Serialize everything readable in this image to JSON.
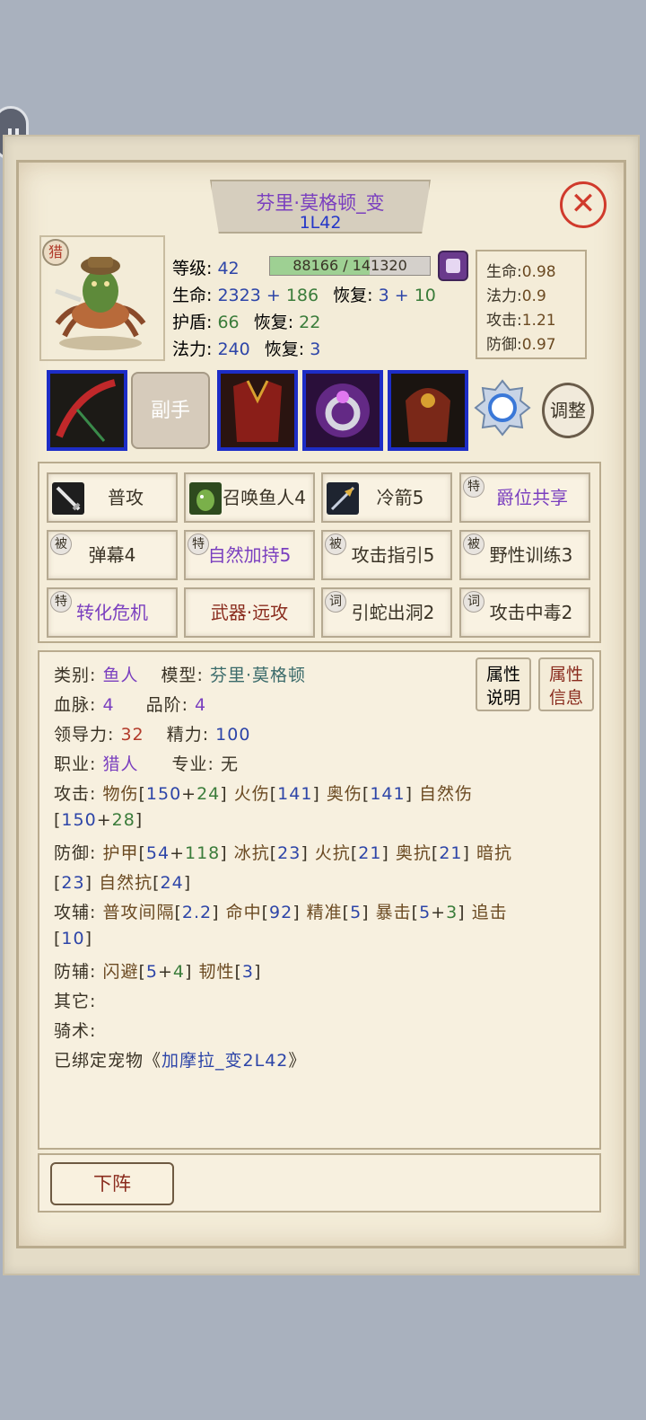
{
  "title": {
    "name": "芬里·莫格顿_变",
    "level": "1L42"
  },
  "badge": "猎",
  "stats": {
    "level_label": "等级:",
    "level_value": "42",
    "exp_text": "88166 / 141320",
    "exp_progress": 0.624,
    "hp_label": "生命:",
    "hp_base": "2323",
    "hp_plus": "+",
    "hp_bonus": "186",
    "hp_regen_label": "恢复:",
    "hp_regen_base": "3",
    "hp_regen_plus": "+",
    "hp_regen_bonus": "10",
    "shield_label": "护盾:",
    "shield_value": "66",
    "shield_regen_label": "恢复:",
    "shield_regen_value": "22",
    "mana_label": "法力:",
    "mana_value": "240",
    "mana_regen_label": "恢复:",
    "mana_regen_value": "3"
  },
  "growth": [
    {
      "label": "生命:",
      "value": "0.98"
    },
    {
      "label": "法力:",
      "value": "0.9"
    },
    {
      "label": "攻击:",
      "value": "1.21"
    },
    {
      "label": "防御:",
      "value": "0.97"
    }
  ],
  "equipment": {
    "offhand_label": "副手",
    "adjust_label": "调整"
  },
  "skills": [
    {
      "label": "普攻",
      "tag": ""
    },
    {
      "label": "召唤鱼人4",
      "tag": ""
    },
    {
      "label": "冷箭5",
      "tag": ""
    },
    {
      "label": "爵位共享",
      "tag": "特"
    },
    {
      "label": "弹幕4",
      "tag": "被"
    },
    {
      "label": "自然加持5",
      "tag": "特"
    },
    {
      "label": "攻击指引5",
      "tag": "被"
    },
    {
      "label": "野性训练3",
      "tag": "被"
    },
    {
      "label": "转化危机",
      "tag": "特"
    },
    {
      "label": "武器·远攻",
      "tag": ""
    },
    {
      "label": "引蛇出洞2",
      "tag": "词"
    },
    {
      "label": "攻击中毒2",
      "tag": "词"
    }
  ],
  "info": {
    "category_label": "类别:",
    "category_value": "鱼人",
    "model_label": "模型:",
    "model_value": "芬里·莫格顿",
    "bloodline_label": "血脉:",
    "bloodline_value": "4",
    "grade_label": "品阶:",
    "grade_value": "4",
    "leadership_label": "领导力:",
    "leadership_value": "32",
    "energy_label": "精力:",
    "energy_value": "100",
    "job_label": "职业:",
    "job_value": "猎人",
    "specialty_label": "专业:",
    "specialty_value": "无",
    "attack_label": "攻击:",
    "phys_label": "物伤",
    "phys_base": "150",
    "phys_bonus": "24",
    "fire_label": "火伤",
    "fire_value": "141",
    "arcane_label": "奥伤",
    "arcane_value": "141",
    "nature_label": "自然伤",
    "nature_base": "150",
    "nature_bonus": "28",
    "defense_label": "防御:",
    "armor_label": "护甲",
    "armor_base": "54",
    "armor_bonus": "118",
    "ice_res_label": "冰抗",
    "ice_res_value": "23",
    "fire_res_label": "火抗",
    "fire_res_value": "21",
    "arcane_res_label": "奥抗",
    "arcane_res_value": "21",
    "shadow_res_label": "暗抗",
    "shadow_res_value": "23",
    "nature_res_label": "自然抗",
    "nature_res_value": "24",
    "atk_aux_label": "攻辅:",
    "interval_label": "普攻间隔",
    "interval_value": "2.2",
    "hit_label": "命中",
    "hit_value": "92",
    "precision_label": "精准",
    "precision_value": "5",
    "crit_label": "暴击",
    "crit_base": "5",
    "crit_bonus": "3",
    "chase_label": "追击",
    "chase_value": "10",
    "def_aux_label": "防辅:",
    "dodge_label": "闪避",
    "dodge_base": "5",
    "dodge_bonus": "4",
    "tough_label": "韧性",
    "tough_value": "3",
    "other_label": "其它:",
    "riding_label": "骑术:",
    "bound_pet_prefix": "已绑定宠物",
    "bound_pet_name": "加摩拉_变2L42",
    "attr_desc_button": "属性说明",
    "attr_info_button": "属性信息"
  },
  "bottom": {
    "leave_label": "下阵"
  }
}
